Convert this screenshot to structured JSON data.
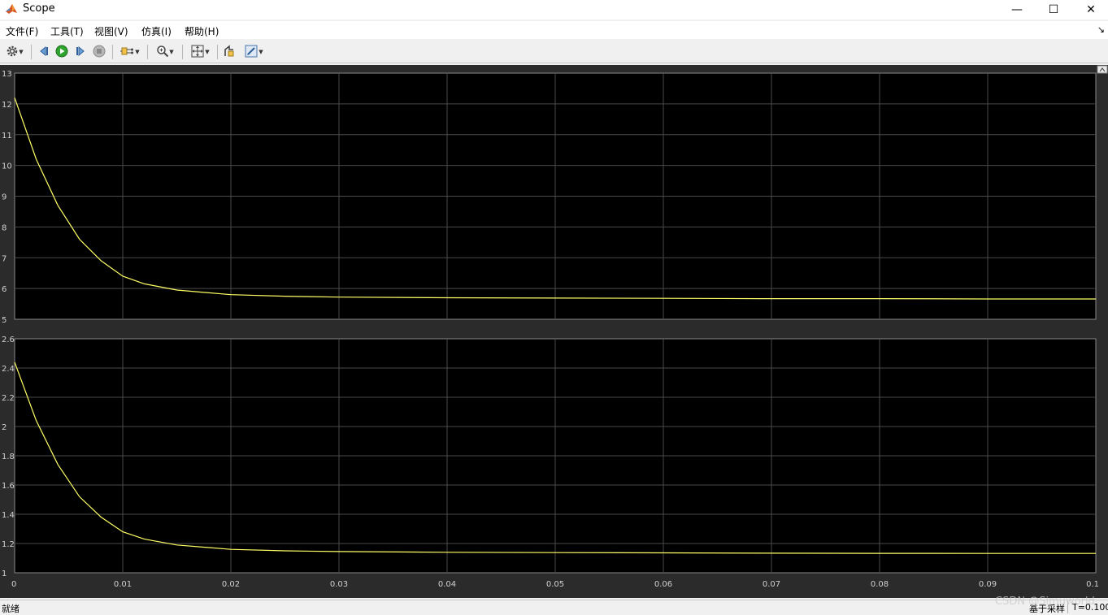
{
  "window": {
    "title": "Scope",
    "minimize_glyph": "—",
    "maximize_glyph": "☐",
    "close_glyph": "✕"
  },
  "menu": {
    "items": [
      "文件(F)",
      "工具(T)",
      "视图(V)",
      "仿真(I)",
      "帮助(H)"
    ],
    "overflow_glyph": "↘"
  },
  "toolbar": {
    "icons": [
      "gear-icon",
      "step-back-icon",
      "run-icon",
      "step-forward-icon",
      "stop-icon",
      "signal-selection-icon",
      "zoom-icon",
      "autoscale-icon",
      "highlight-block-icon",
      "style-icon"
    ]
  },
  "colors": {
    "plot_background": "#000000",
    "figure_background": "#2b2b2b",
    "grid": "#4a4a4a",
    "axis_text": "#d0d0d0",
    "signal": "#ffff66"
  },
  "chart_data": [
    {
      "type": "line",
      "title": "",
      "xlabel": "",
      "ylabel": "",
      "xlim": [
        0,
        0.1
      ],
      "ylim": [
        5,
        13
      ],
      "x_ticks": [
        "0",
        "0.01",
        "0.02",
        "0.03",
        "0.04",
        "0.05",
        "0.06",
        "0.07",
        "0.08",
        "0.09",
        "0.1"
      ],
      "y_ticks": [
        "5",
        "6",
        "7",
        "8",
        "9",
        "10",
        "11",
        "12",
        "13"
      ],
      "grid": true,
      "series": [
        {
          "x": [
            0,
            0.002,
            0.004,
            0.006,
            0.008,
            0.01,
            0.012,
            0.015,
            0.02,
            0.025,
            0.03,
            0.04,
            0.05,
            0.06,
            0.069,
            0.08,
            0.09,
            0.1
          ],
          "values": [
            12.2,
            10.2,
            8.7,
            7.6,
            6.9,
            6.4,
            6.15,
            5.95,
            5.8,
            5.75,
            5.72,
            5.7,
            5.69,
            5.68,
            5.67,
            5.67,
            5.66,
            5.66
          ]
        }
      ]
    },
    {
      "type": "line",
      "title": "",
      "xlabel": "",
      "ylabel": "",
      "xlim": [
        0,
        0.1
      ],
      "ylim": [
        1,
        2.6
      ],
      "x_ticks": [
        "0",
        "0.01",
        "0.02",
        "0.03",
        "0.04",
        "0.05",
        "0.06",
        "0.07",
        "0.08",
        "0.09",
        "0.1"
      ],
      "y_ticks": [
        "1",
        "1.2",
        "1.4",
        "1.6",
        "1.8",
        "2",
        "2.2",
        "2.4",
        "2.6"
      ],
      "grid": true,
      "series": [
        {
          "x": [
            0,
            0.002,
            0.004,
            0.006,
            0.008,
            0.01,
            0.012,
            0.015,
            0.02,
            0.025,
            0.03,
            0.04,
            0.05,
            0.06,
            0.069,
            0.08,
            0.09,
            0.1
          ],
          "values": [
            2.44,
            2.04,
            1.74,
            1.52,
            1.38,
            1.28,
            1.23,
            1.19,
            1.16,
            1.15,
            1.145,
            1.14,
            1.138,
            1.136,
            1.134,
            1.133,
            1.132,
            1.132
          ]
        }
      ]
    }
  ],
  "status": {
    "left": "就绪",
    "mode": "基于采样",
    "time": "T=0.100"
  },
  "watermark": "CSDN @Simuworld"
}
